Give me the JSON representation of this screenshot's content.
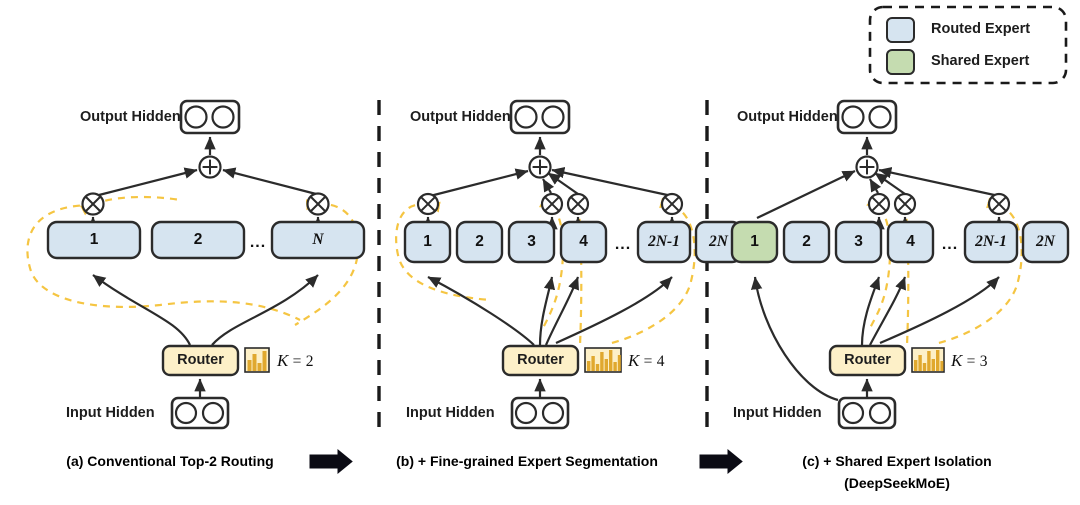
{
  "figure": {
    "title": "DeepSeekMoE architecture comparison",
    "colors": {
      "routed_expert_fill": "#d6e4f0",
      "shared_expert_fill": "#c5dcb0",
      "router_fill": "#fdf0c8",
      "stroke": "#2b2b2b",
      "gate_dashed": "#f5c542",
      "divider": "#1a1a1a",
      "background": "#ffffff"
    }
  },
  "legend": {
    "items": [
      {
        "label": "Routed Expert",
        "color": "#d6e4f0",
        "icon": "rounded-square-swatch"
      },
      {
        "label": "Shared Expert",
        "color": "#c5dcb0",
        "icon": "rounded-square-swatch"
      }
    ]
  },
  "panels": [
    {
      "id": "a",
      "caption": "(a) Conventional Top-2 Routing",
      "caption_line2": "",
      "output_label": "Output Hidden",
      "input_label": "Input Hidden",
      "router_label": "Router",
      "k_symbol": "K",
      "k_equals": "=",
      "k_value": "2",
      "gate_icon": "bar-chart-icon",
      "sum_icon": "plus-circle-icon",
      "experts": [
        {
          "id": "a1",
          "label": "1",
          "italic": false,
          "type": "routed",
          "selected": true
        },
        {
          "id": "a2",
          "label": "2",
          "italic": false,
          "type": "routed",
          "selected": false
        },
        {
          "id": "adots",
          "label": "...",
          "italic": false,
          "type": "ellipsis",
          "selected": false
        },
        {
          "id": "aN",
          "label": "N",
          "italic": true,
          "type": "routed",
          "selected": true
        }
      ],
      "num_multipliers": 2
    },
    {
      "id": "b",
      "caption": "(b) + Fine-grained Expert Segmentation",
      "caption_line2": "",
      "output_label": "Output Hidden",
      "input_label": "Input Hidden",
      "router_label": "Router",
      "k_symbol": "K",
      "k_equals": "=",
      "k_value": "4",
      "gate_icon": "bar-chart-icon",
      "sum_icon": "plus-circle-icon",
      "experts": [
        {
          "id": "b1",
          "label": "1",
          "italic": false,
          "type": "routed",
          "selected": true
        },
        {
          "id": "b2",
          "label": "2",
          "italic": false,
          "type": "routed",
          "selected": false
        },
        {
          "id": "b3",
          "label": "3",
          "italic": false,
          "type": "routed",
          "selected": false
        },
        {
          "id": "b4",
          "label": "4",
          "italic": false,
          "type": "routed",
          "selected": true
        },
        {
          "id": "bdots",
          "label": "...",
          "italic": false,
          "type": "ellipsis",
          "selected": true
        },
        {
          "id": "b2N1",
          "label": "2N-1",
          "italic": true,
          "type": "routed",
          "selected": false
        },
        {
          "id": "b2N",
          "label": "2N",
          "italic": true,
          "type": "routed",
          "selected": true
        }
      ],
      "num_multipliers": 4
    },
    {
      "id": "c",
      "caption": "(c) + Shared Expert Isolation",
      "caption_line2": "(DeepSeekMoE)",
      "output_label": "Output Hidden",
      "input_label": "Input Hidden",
      "router_label": "Router",
      "k_symbol": "K",
      "k_equals": "=",
      "k_value": "3",
      "gate_icon": "bar-chart-icon",
      "sum_icon": "plus-circle-icon",
      "experts": [
        {
          "id": "c1",
          "label": "1",
          "italic": false,
          "type": "shared",
          "selected": true
        },
        {
          "id": "c2",
          "label": "2",
          "italic": false,
          "type": "routed",
          "selected": false
        },
        {
          "id": "c3",
          "label": "3",
          "italic": false,
          "type": "routed",
          "selected": false
        },
        {
          "id": "c4",
          "label": "4",
          "italic": false,
          "type": "routed",
          "selected": true
        },
        {
          "id": "cdots",
          "label": "...",
          "italic": false,
          "type": "ellipsis",
          "selected": true
        },
        {
          "id": "c2N1",
          "label": "2N-1",
          "italic": true,
          "type": "routed",
          "selected": false
        },
        {
          "id": "c2N",
          "label": "2N",
          "italic": true,
          "type": "routed",
          "selected": true
        }
      ],
      "num_multipliers": 3
    }
  ],
  "flow_arrows": [
    {
      "id": "arrow-a-to-b",
      "icon": "block-arrow-right-icon"
    },
    {
      "id": "arrow-b-to-c",
      "icon": "block-arrow-right-icon"
    }
  ]
}
